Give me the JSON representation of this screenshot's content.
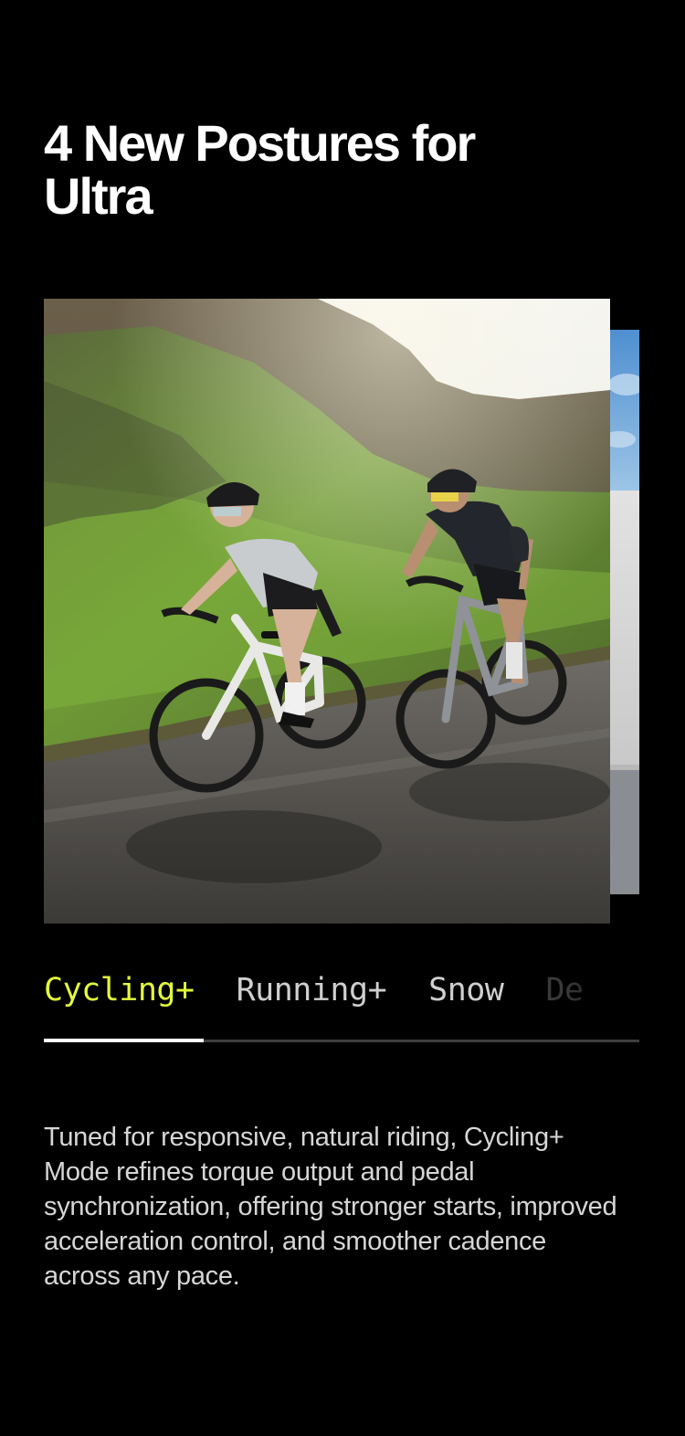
{
  "heading": {
    "title": "4 New Postures for Ultra"
  },
  "carousel": {
    "current_image": "cycling-photo",
    "next_image": "running-photo"
  },
  "tabs": {
    "active_index": 0,
    "progress": 0.268,
    "items": [
      {
        "label": "Cycling+"
      },
      {
        "label": "Running+"
      },
      {
        "label": "Snow"
      },
      {
        "label": "De"
      }
    ]
  },
  "description": {
    "text": "Tuned for responsive, natural riding, Cycling+ Mode refines torque output and pedal synchronization, offering stronger starts, improved acceleration control, and smoother cadence across any pace."
  },
  "colors": {
    "background": "#000000",
    "accent": "#e4ff3a",
    "tab_inactive": "#cfcfcf",
    "track": "#3d3d3d",
    "body_text": "#d6d6d6"
  }
}
